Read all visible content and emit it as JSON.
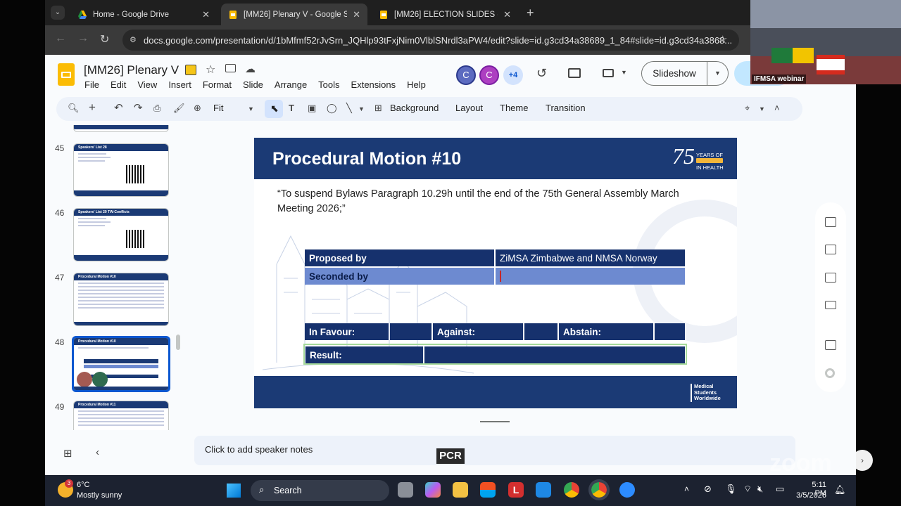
{
  "browser": {
    "tabs": [
      {
        "title": "Home - Google Drive",
        "icon": "google-drive-icon",
        "active": false
      },
      {
        "title": "[MM26] Plenary V - Google Slid",
        "icon": "google-slides-icon",
        "active": true
      },
      {
        "title": "[MM26] ELECTION SLIDES - Goo",
        "icon": "google-slides-icon",
        "active": false
      }
    ],
    "url": "docs.google.com/presentation/d/1bMfmf52rJvSrn_JQHlp93tFxjNim0VlblSNrdl3aPW4/edit?slide=id.g3cd34a38689_1_84#slide=id.g3cd34a3868..."
  },
  "app": {
    "doc_title": "[MM26] Plenary V",
    "menu": [
      "File",
      "Edit",
      "View",
      "Insert",
      "Format",
      "Slide",
      "Arrange",
      "Tools",
      "Extensions",
      "Help"
    ],
    "collaborators": [
      "C",
      "C"
    ],
    "collaborators_more": "+4",
    "slideshow_label": "Slideshow",
    "toolbar": {
      "zoom": "Fit",
      "background": "Background",
      "layout": "Layout",
      "theme": "Theme",
      "transition": "Transition"
    },
    "speaker_notes_placeholder": "Click to add speaker notes",
    "colors": {
      "slide_navy": "#1b3a75",
      "slide_light": "#6d8ad0",
      "result_border": "#a5d99a"
    }
  },
  "filmstrip": [
    {
      "num": "45",
      "title": "Speakers' List 28"
    },
    {
      "num": "46",
      "title": "Speakers' List 29 TW-Conflicts"
    },
    {
      "num": "47",
      "title": "Procedural Motion #10"
    },
    {
      "num": "48",
      "title": "Procedural Motion #10",
      "selected": true
    },
    {
      "num": "49",
      "title": "Procedural Motion #11"
    }
  ],
  "slide": {
    "title": "Procedural Motion #10",
    "logo_number": "75",
    "logo_text_1": "YEARS OF",
    "logo_text_2": "IN HEALTH",
    "quote": "“To suspend Bylaws Paragraph 10.29h until the end of the 75th General Assembly March Meeting 2026;”",
    "proposed_label": "Proposed by",
    "proposed_value": "ZiMSA Zimbabwe and NMSA Norway",
    "seconded_label": "Seconded by",
    "seconded_value": "",
    "in_favour_label": "In Favour:",
    "against_label": "Against:",
    "abstain_label": "Abstain:",
    "result_label": "Result:",
    "footer_logo": [
      "Medical",
      "Students",
      "Worldwide"
    ]
  },
  "overlay": {
    "pcr_label": "PCR",
    "webcam_label": "IFMSA webinar",
    "zoom_watermark": "zoom"
  },
  "taskbar": {
    "weather_temp": "6°C",
    "weather_desc": "Mostly sunny",
    "weather_badge": "3",
    "search_label": "Search",
    "app_icons": [
      "task-view-icon",
      "copilot-icon",
      "file-explorer-icon",
      "store-icon",
      "l-app-icon",
      "edit-app-icon",
      "chrome-icon",
      "chrome-active-icon",
      "zoom-app-icon"
    ],
    "time": "5:11 PM",
    "date": "3/5/2026"
  }
}
